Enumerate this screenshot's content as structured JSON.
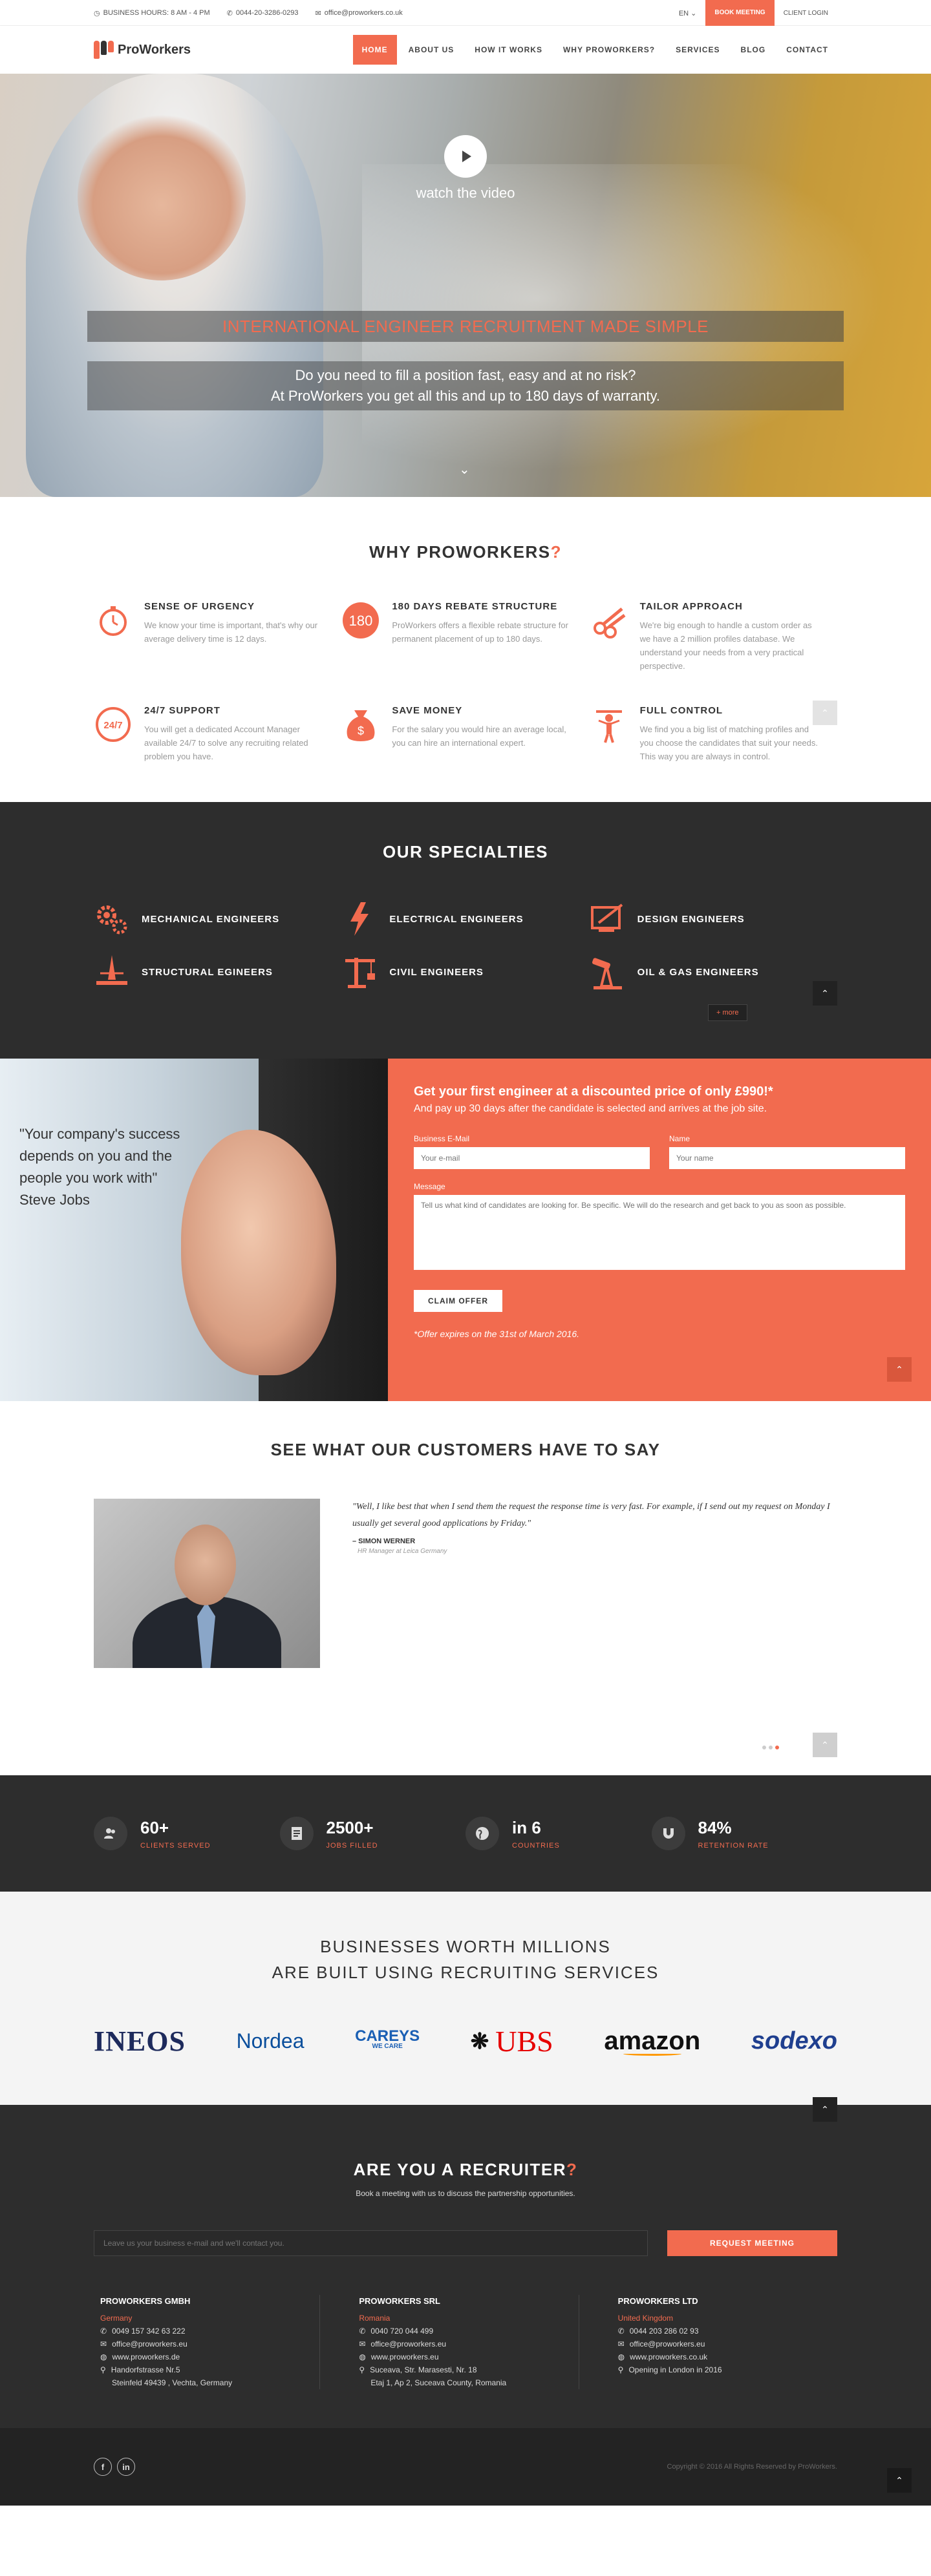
{
  "topbar": {
    "hours": "BUSINESS HOURS: 8 AM - 4 PM",
    "phone": "0044-20-3286-0293",
    "email": "office@proworkers.co.uk",
    "lang": "EN",
    "book": "BOOK MEETING",
    "login": "CLIENT LOGIN"
  },
  "brand": {
    "name": "ProWorkers",
    "accent": "#f26b4f"
  },
  "menu": [
    "HOME",
    "ABOUT US",
    "HOW IT WORKS",
    "WHY PROWORKERS?",
    "SERVICES",
    "BLOG",
    "CONTACT"
  ],
  "hero": {
    "watch": "watch the video",
    "title": "INTERNATIONAL ENGINEER RECRUITMENT MADE SIMPLE",
    "line1": "Do you need to fill a position fast, easy and at no risk?",
    "line2": "At ProWorkers you get all this and up to 180 days of warranty."
  },
  "why": {
    "title": "WHY PROWORKERS",
    "mark": "?",
    "features": [
      {
        "icon": "stopwatch-icon",
        "title": "SENSE OF URGENCY",
        "text": "We know your time is important, that's why our average delivery time is 12 days."
      },
      {
        "icon": "180-badge-icon",
        "title": "180 DAYS REBATE STRUCTURE",
        "text": "ProWorkers offers a flexible rebate structure for permanent placement of up to 180 days."
      },
      {
        "icon": "scissors-icon",
        "title": "TAILOR APPROACH",
        "text": "We're big enough to handle a custom order as we have a 2 million profiles database. We understand your needs from a very practical perspective."
      },
      {
        "icon": "247-support-icon",
        "title": "24/7 SUPPORT",
        "text": "You will get a dedicated Account Manager available 24/7 to solve any recruiting related problem you have."
      },
      {
        "icon": "money-bag-icon",
        "title": "SAVE MONEY",
        "text": "For the salary you would hire an average local, you can hire an international expert."
      },
      {
        "icon": "puppet-icon",
        "title": "FULL CONTROL",
        "text": "We find you a big list of matching profiles and you choose the candidates that suit your needs. This way you are always in control."
      }
    ]
  },
  "spec": {
    "title": "OUR SPECIALTIES",
    "items": [
      {
        "icon": "gears-icon",
        "label": "MECHANICAL ENGINEERS"
      },
      {
        "icon": "lightning-icon",
        "label": "ELECTRICAL ENGINEERS"
      },
      {
        "icon": "drafting-icon",
        "label": "DESIGN ENGINEERS"
      },
      {
        "icon": "tower-icon",
        "label": "STRUCTURAL EGINEERS"
      },
      {
        "icon": "crane-icon",
        "label": "CIVIL ENGINEERS"
      },
      {
        "icon": "oil-pump-icon",
        "label": "OIL & GAS ENGINEERS"
      }
    ],
    "more": "+ more"
  },
  "offer": {
    "quote": "\"Your company's success depends on you and the people you work with\"",
    "author": "Steve Jobs",
    "headline": "Get your first engineer at a discounted price of only £990!*",
    "sub": "And pay up 30 days after the candidate is selected and arrives at the job site.",
    "email_label": "Business E-Mail",
    "email_ph": "Your e-mail",
    "name_label": "Name",
    "name_ph": "Your name",
    "msg_label": "Message",
    "msg_ph": "Tell us what kind of candidates are looking for. Be specific. We will do the research and get back to you as soon as possible.",
    "claim": "CLAIM OFFER",
    "expires": "*Offer expires on the 31st of March 2016."
  },
  "testi": {
    "title": "SEE WHAT OUR CUSTOMERS HAVE TO SAY",
    "quote": "\"Well, I like best that when I send them the request the response time is very fast. For example, if I send out my request on Monday I usually get several good applications by Friday.\"",
    "name": "– SIMON WERNER",
    "role": "HR Manager at Leica Germany"
  },
  "stats": [
    {
      "icon": "users-icon",
      "num": "60+",
      "label": "CLIENTS SERVED"
    },
    {
      "icon": "document-icon",
      "num": "2500+",
      "label": "JOBS FILLED"
    },
    {
      "icon": "globe-icon",
      "num": "in 6",
      "label": "COUNTRIES"
    },
    {
      "icon": "magnet-icon",
      "num": "84%",
      "label": "RETENTION RATE"
    }
  ],
  "clients": {
    "line1": "BUSINESSES WORTH MILLIONS",
    "line2": "ARE BUILT USING RECRUITING SERVICES",
    "logos": [
      "INEOS",
      "Nordea",
      "CAREYS",
      "WE CARE",
      "UBS",
      "amazon",
      "sodexo"
    ]
  },
  "recruit": {
    "title": "ARE YOU A RECRUITER",
    "mark": "?",
    "lead": "Book a meeting with us to discuss the partnership opportunities.",
    "input_ph": "Leave us your business e-mail and we'll contact you.",
    "button": "REQUEST MEETING",
    "offices": [
      {
        "name": "PROWORKERS GMBH",
        "country": "Germany",
        "phone": "0049 157 342 63 222",
        "email": "office@proworkers.eu",
        "web": "www.proworkers.de",
        "addr1": "Handorfstrasse Nr.5",
        "addr2": "Steinfeld 49439 , Vechta, Germany"
      },
      {
        "name": "PROWORKERS SRL",
        "country": "Romania",
        "phone": "0040 720 044 499",
        "email": "office@proworkers.eu",
        "web": "www.proworkers.eu",
        "addr1": "Suceava, Str. Marasesti, Nr. 18",
        "addr2": "Etaj 1, Ap 2, Suceava County, Romania"
      },
      {
        "name": "PROWORKERS LTD",
        "country": "United Kingdom",
        "phone": "0044 203 286 02 93",
        "email": "office@proworkers.eu",
        "web": "www.proworkers.co.uk",
        "addr1": "Opening in London in 2016",
        "addr2": ""
      }
    ]
  },
  "footer": {
    "social": [
      "f",
      "in"
    ],
    "copy": "Copyright © 2016 All Rights Reserved by ProWorkers."
  }
}
